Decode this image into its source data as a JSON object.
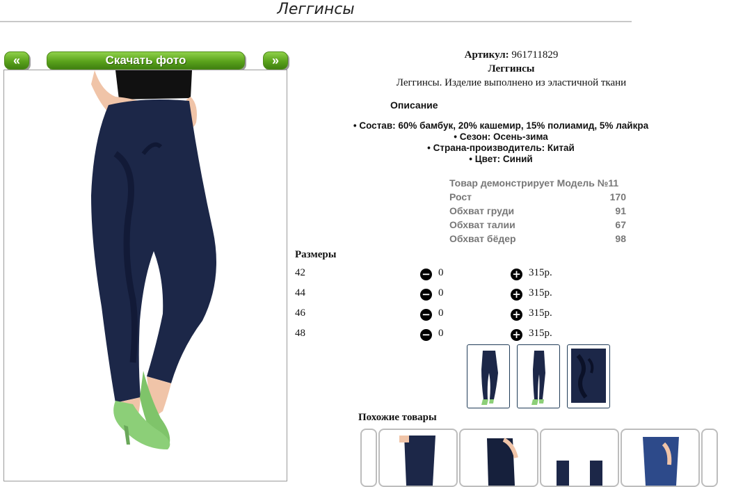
{
  "page": {
    "title": "Леггинсы"
  },
  "gallery": {
    "prev_label": "«",
    "next_label": "»",
    "download_label": "Скачать фото"
  },
  "product": {
    "article_label": "Артикул:",
    "article_value": "961711829",
    "name": "Леггинсы",
    "summary": "Леггинсы. Изделие выполнено из эластичной ткани",
    "description_heading": "Описание",
    "bullets": [
      "• Состав: 60% бамбук, 20% кашемир, 15% полиамид, 5% лайкра",
      "• Сезон: Осень-зима",
      "• Страна-производитель: Китай",
      "• Цвет: Синий"
    ]
  },
  "model": {
    "heading": "Товар демонстрирует Модель №11",
    "rows": [
      {
        "label": "Рост",
        "value": "170"
      },
      {
        "label": "Обхват груди",
        "value": "91"
      },
      {
        "label": "Обхват талии",
        "value": "67"
      },
      {
        "label": "Обхват бёдер",
        "value": "98"
      }
    ]
  },
  "sizes": {
    "heading": "Размеры",
    "rows": [
      {
        "size": "42",
        "qty": "0",
        "price": "315р."
      },
      {
        "size": "44",
        "qty": "0",
        "price": "315р."
      },
      {
        "size": "46",
        "qty": "0",
        "price": "315р."
      },
      {
        "size": "48",
        "qty": "0",
        "price": "315р."
      }
    ]
  },
  "similar": {
    "heading": "Похожие товары"
  },
  "colors": {
    "accent_green": "#5aa21c",
    "legging_navy": "#1c2748",
    "price_muted": "#777777"
  },
  "icons": {
    "decrease": "minus-circle-icon",
    "increase": "plus-circle-icon"
  }
}
